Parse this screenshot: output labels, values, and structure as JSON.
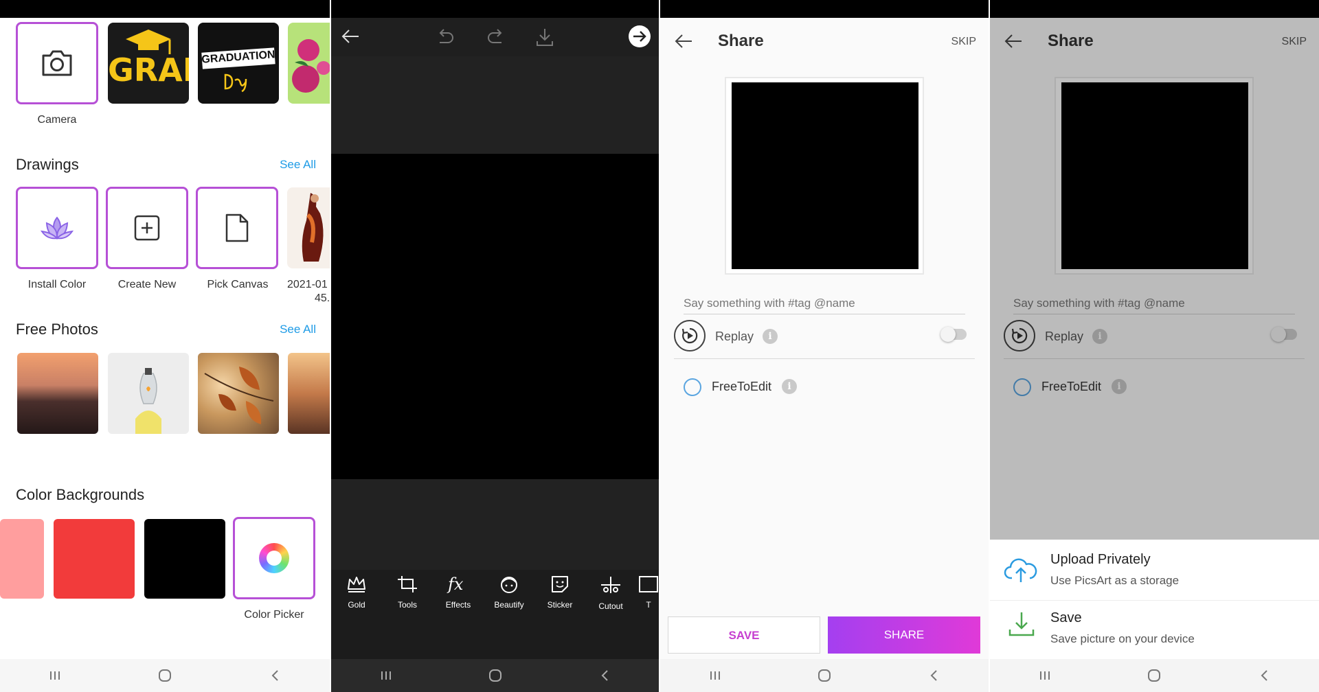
{
  "colors": {
    "accent_purple": "#b650d6",
    "link_blue": "#1e9be6",
    "share_gradient_start": "#a43ff0",
    "share_gradient_end": "#e03ad8",
    "save_text": "#c63fd0"
  },
  "home": {
    "top_tiles": [
      {
        "label": "Camera",
        "icon": "camera-icon"
      },
      {
        "label": "",
        "image_text": "GRAD"
      },
      {
        "label": "",
        "image_text": "GRADUATION"
      },
      {
        "label": "",
        "image": "pink-roses"
      }
    ],
    "drawings": {
      "heading": "Drawings",
      "see_all": "See All",
      "items": [
        {
          "label": "Install Color",
          "icon": "lotus-icon"
        },
        {
          "label": "Create New",
          "icon": "plus-square-icon"
        },
        {
          "label": "Pick Canvas",
          "icon": "document-icon"
        },
        {
          "label": "2021-01",
          "label_line2": "45."
        }
      ]
    },
    "free_photos": {
      "heading": "Free Photos",
      "see_all": "See All"
    },
    "color_backgrounds": {
      "heading": "Color Backgrounds",
      "swatches": [
        "#ff9e9e",
        "#f23b3b",
        "#000000"
      ],
      "picker_label": "Color Picker"
    }
  },
  "editor": {
    "tools": [
      {
        "label": "Gold",
        "icon": "crown-icon"
      },
      {
        "label": "Tools",
        "icon": "crop-icon"
      },
      {
        "label": "Effects",
        "icon": "fx-icon"
      },
      {
        "label": "Beautify",
        "icon": "face-icon"
      },
      {
        "label": "Sticker",
        "icon": "sticker-icon"
      },
      {
        "label": "Cutout",
        "icon": "scissors-icon"
      },
      {
        "label": "T",
        "icon": "text-icon"
      }
    ]
  },
  "share": {
    "title": "Share",
    "skip": "SKIP",
    "caption_placeholder": "Say something with #tag @name",
    "replay_label": "Replay",
    "free_to_edit_label": "FreeToEdit",
    "info_glyph": "i",
    "save_button": "SAVE",
    "share_button": "SHARE"
  },
  "share_sheet": {
    "upload_title": "Upload Privately",
    "upload_sub": "Use PicsArt as a storage",
    "save_title": "Save",
    "save_sub": "Save picture on your device"
  }
}
